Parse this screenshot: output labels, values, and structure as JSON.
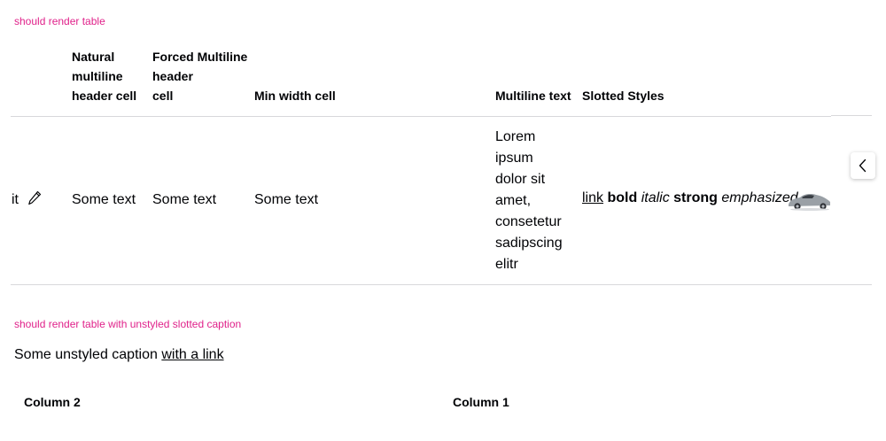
{
  "test1": {
    "label": "should render table",
    "headers": {
      "natural_multiline": [
        "Natural",
        "multiline",
        "header cell"
      ],
      "forced_multiline": [
        "Forced Multiline",
        "header",
        "cell"
      ],
      "min_width": "Min width cell",
      "multiline_text": "Multiline text",
      "slotted_styles": "Slotted Styles"
    },
    "row": {
      "first_cell_text": "it",
      "cell_natural": "Some text",
      "cell_forced": "Some text",
      "cell_min_width": "Some text",
      "multiline_lines": [
        "Lorem",
        "ipsum",
        "dolor sit",
        "amet,",
        "consetetur",
        "sadipscing",
        "elitr"
      ],
      "slotted": {
        "link": "link",
        "bold": "bold",
        "italic": "italic",
        "strong": "strong",
        "emphasized": "emphasized"
      }
    },
    "scroll_button_icon": "chevron-left-icon",
    "edit_icon": "pencil-icon",
    "image_icon": "car-image"
  },
  "test2": {
    "label": "should render table with unstyled slotted caption",
    "caption_text": "Some unstyled caption ",
    "caption_link": "with a link",
    "columns": [
      "Column 2",
      "Column 1"
    ]
  },
  "colors": {
    "label": "#e0218a",
    "text": "#010205",
    "divider": "#d8d8db"
  }
}
